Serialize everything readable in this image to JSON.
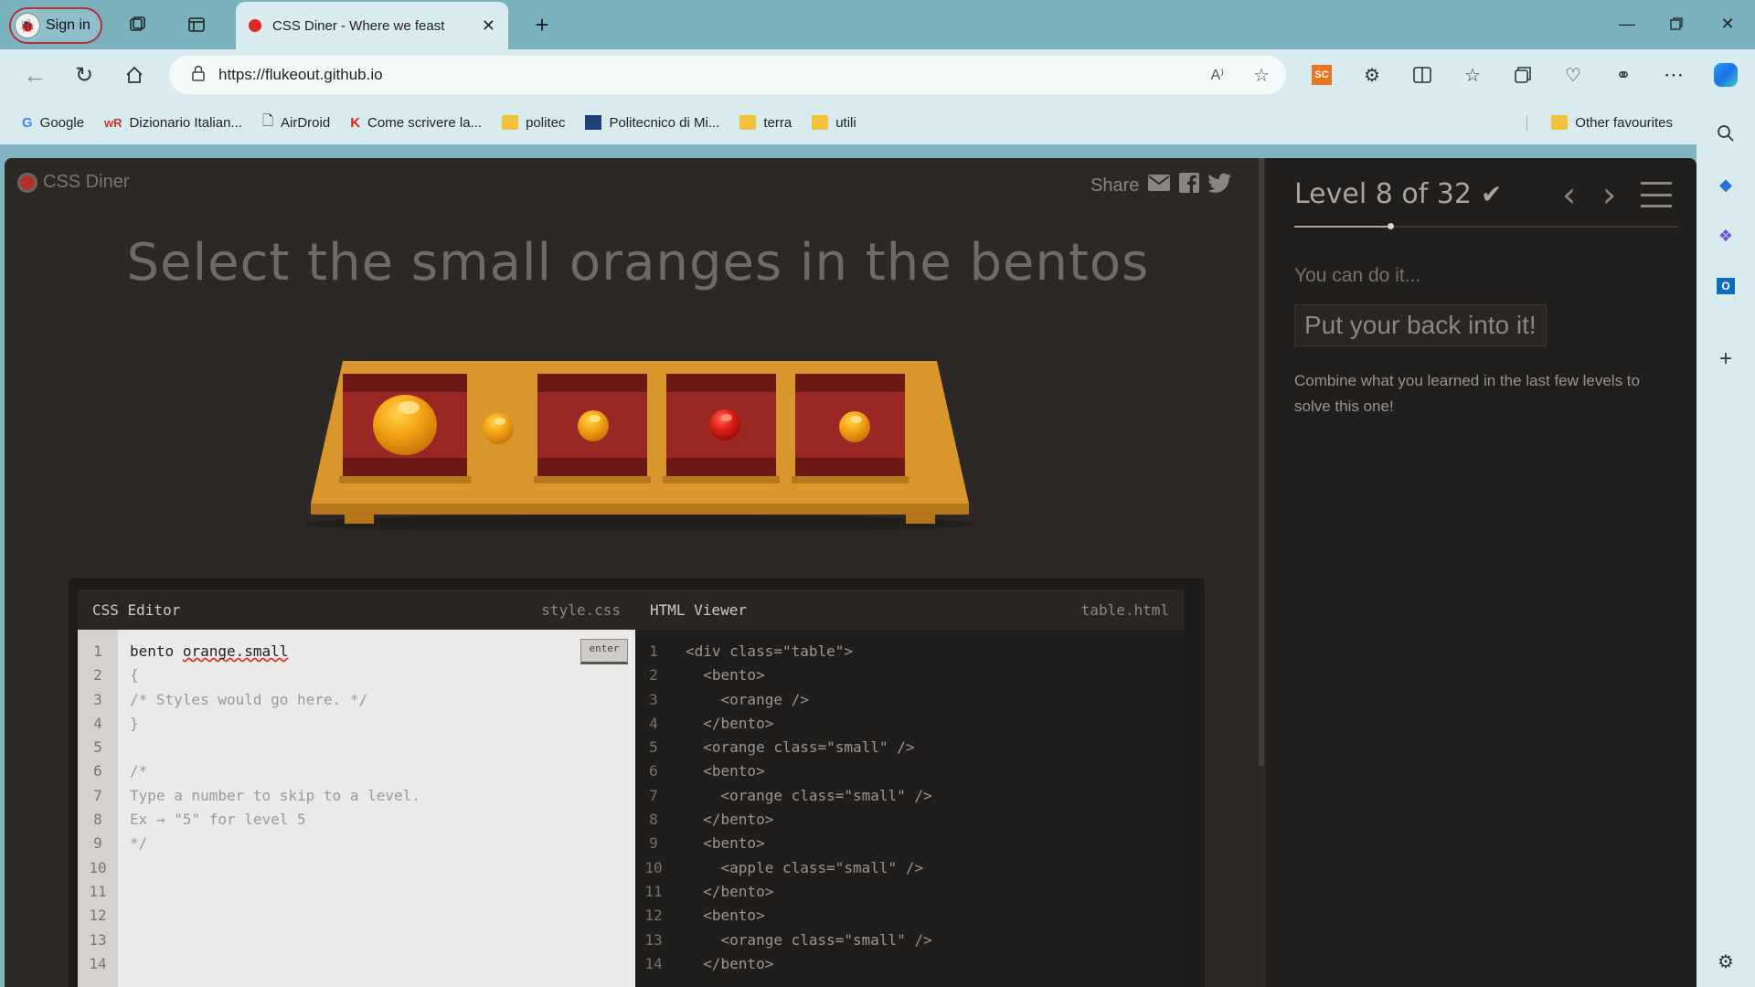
{
  "browser": {
    "signin_label": "Sign in",
    "tab_title": "CSS Diner - Where we feast",
    "url": "https://flukeout.github.io",
    "bookmarks": [
      {
        "label": "Google",
        "icon": "google-icon"
      },
      {
        "label": "Dizionario Italian...",
        "icon": "wordreference-icon"
      },
      {
        "label": "AirDroid",
        "icon": "page-icon"
      },
      {
        "label": "Come scrivere la...",
        "icon": "k-icon"
      },
      {
        "label": "politec",
        "icon": "folder-icon"
      },
      {
        "label": "Politecnico di Mi...",
        "icon": "polimi-icon"
      },
      {
        "label": "terra",
        "icon": "folder-icon"
      },
      {
        "label": "utili",
        "icon": "folder-icon"
      }
    ],
    "other_favourites": "Other favourites"
  },
  "game": {
    "logo": "CSS Diner",
    "share_label": "Share",
    "instruction": "Select the small oranges in the bentos"
  },
  "editor": {
    "css_title": "CSS Editor",
    "css_file": "style.css",
    "html_title": "HTML Viewer",
    "html_file": "table.html",
    "enter_label": "enter",
    "css_input": "bento orange.small",
    "css_lines": [
      "{",
      "/* Styles would go here. */",
      "}",
      "",
      "/*",
      "Type a number to skip to a level.",
      "Ex → \"5\" for level 5",
      "*/",
      "",
      "",
      "",
      "",
      ""
    ],
    "line_numbers": [
      "1",
      "2",
      "3",
      "4",
      "5",
      "6",
      "7",
      "8",
      "9",
      "10",
      "11",
      "12",
      "13",
      "14"
    ],
    "html_lines": [
      "<div class=\"table\">",
      "  <bento>",
      "    <orange />",
      "  </bento>",
      "  <orange class=\"small\" />",
      "  <bento>",
      "    <orange class=\"small\" />",
      "  </bento>",
      "  <bento>",
      "    <apple class=\"small\" />",
      "  </bento>",
      "  <bento>",
      "    <orange class=\"small\" />",
      "  </bento>"
    ]
  },
  "panel": {
    "level_text": "Level 8 of 32",
    "level_current": 8,
    "level_total": 32,
    "hint": "You can do it...",
    "selector_name": "Put your back into it!",
    "description": "Combine what you learned in the last few levels to solve this one!"
  },
  "colors": {
    "accent_red": "#b3312d",
    "orange": "#f2a417",
    "apple": "#d81f1f",
    "table_wood": "#d8962c"
  }
}
